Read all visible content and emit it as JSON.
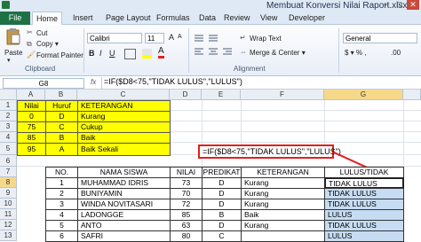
{
  "window": {
    "title": "Membuat Konversi Nilai Raport.xlsx -",
    "min": "–",
    "max": "□",
    "close": "✕"
  },
  "tabs": {
    "file": "File",
    "items": [
      "Home",
      "Insert",
      "Page Layout",
      "Formulas",
      "Data",
      "Review",
      "View",
      "Developer"
    ]
  },
  "ribbon": {
    "cut": "Cut",
    "copy": "Copy ▾",
    "format_painter": "Format Painter",
    "paste": "Paste",
    "clipboard": "Clipboard",
    "font_name": "Calibri",
    "font_size": "11",
    "bold": "B",
    "italic": "I",
    "underline": "U",
    "grow_font": "A",
    "shrink_font": "A",
    "wrap_text": "Wrap Text",
    "merge_center": "Merge & Center ▾",
    "alignment": "Alignment",
    "number_format": "General",
    "currency": "$ ▾ % ,",
    "decimals": ".00",
    "brand_color": "#1e7145"
  },
  "formula_bar": {
    "name_box": "G8",
    "fx": "fx",
    "formula": "=IF($D8<75,\"TIDAK LULUS\",\"LULUS\")"
  },
  "columns": [
    "A",
    "B",
    "C",
    "D",
    "E",
    "F",
    "G"
  ],
  "rows": [
    "1",
    "2",
    "3",
    "4",
    "5",
    "6",
    "7",
    "8",
    "9",
    "10",
    "11",
    "12",
    "13"
  ],
  "legend_table": {
    "headers": [
      "Nilai",
      "Huruf",
      "KETERANGAN"
    ],
    "rows": [
      [
        "0",
        "D",
        "Kurang"
      ],
      [
        "75",
        "C",
        "Cukup"
      ],
      [
        "85",
        "B",
        "Baik"
      ],
      [
        "95",
        "A",
        "Baik Sekali"
      ]
    ]
  },
  "callout": {
    "text": "=IF($D8<75,\"TIDAK LULUS\",\"LULUS\")",
    "color": "#e02020"
  },
  "main_table": {
    "headers": [
      "NO.",
      "NAMA SISWA",
      "NILAI",
      "PREDIKAT",
      "KETERANGAN",
      "LULUS/TIDAK"
    ],
    "rows": [
      [
        "1",
        "MUHAMMAD IDRIS",
        "73",
        "D",
        "Kurang",
        "TIDAK LULUS"
      ],
      [
        "2",
        "BUNIYAMIN",
        "70",
        "D",
        "Kurang",
        "TIDAK LULUS"
      ],
      [
        "3",
        "WINDA NOVITASARI",
        "72",
        "D",
        "Kurang",
        "TIDAK LULUS"
      ],
      [
        "4",
        "LADONGGE",
        "85",
        "B",
        "Baik",
        "LULUS"
      ],
      [
        "5",
        "ANTO",
        "63",
        "D",
        "Kurang",
        "TIDAK LULUS"
      ],
      [
        "6",
        "SAFRI",
        "80",
        "C",
        "",
        "LULUS"
      ]
    ]
  }
}
